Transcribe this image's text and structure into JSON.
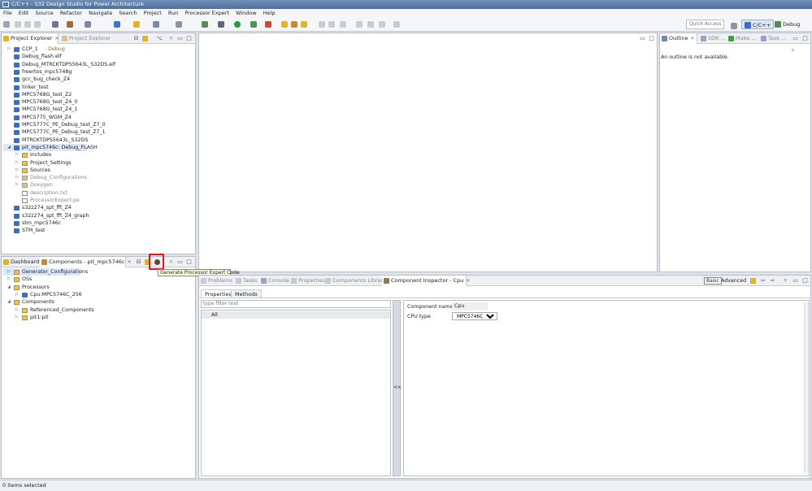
{
  "window": {
    "title": "C/C++ - S32 Design Studio for Power Architecture"
  },
  "menu": [
    "File",
    "Edit",
    "Source",
    "Refactor",
    "Navigate",
    "Search",
    "Project",
    "Run",
    "Processor Expert",
    "Window",
    "Help"
  ],
  "toolbar": {
    "quick_access": "Quick Access",
    "perspective_cpp": "C/C++",
    "perspective_debug": "Debug"
  },
  "project_explorer": {
    "tab_label": "Project Explorer",
    "tab2_label": "Project Explorer",
    "items": [
      {
        "label": "CCP_1",
        "suffix": ": Debug"
      },
      {
        "label": "Debug_flash.elf",
        "suffix": ""
      },
      {
        "label": "Debug_MTRCKTDPS5643L_S32DS.elf",
        "suffix": ""
      },
      {
        "label": "freertos_mpc5748g",
        "suffix": ""
      },
      {
        "label": "gcc_bug_check_Z4",
        "suffix": ""
      },
      {
        "label": "linker_test",
        "suffix": ""
      },
      {
        "label": "MPC5768G_test_Z2",
        "suffix": ""
      },
      {
        "label": "MPC5768G_test_Z4_0",
        "suffix": ""
      },
      {
        "label": "MPC5768G_test_Z4_1",
        "suffix": ""
      },
      {
        "label": "MPC5775_WGM_Z4",
        "suffix": ""
      },
      {
        "label": "MPC5777C_PE_Debug_test_Z7_0",
        "suffix": ""
      },
      {
        "label": "MPC5777C_PE_Debug_test_Z7_1",
        "suffix": ""
      },
      {
        "label": "MTRCKTDPS5643L_S32DS",
        "suffix": ""
      },
      {
        "label": "pit_mpc5746c: Debug_FLASH",
        "suffix": ""
      },
      {
        "label": "Includes",
        "suffix": ""
      },
      {
        "label": "Project_Settings",
        "suffix": ""
      },
      {
        "label": "Sources",
        "suffix": ""
      },
      {
        "label": "Debug_Configurations",
        "suffix": ""
      },
      {
        "label": "Doxygen",
        "suffix": ""
      },
      {
        "label": "description.txt",
        "suffix": ""
      },
      {
        "label": "ProcessorExpert.pe",
        "suffix": ""
      },
      {
        "label": "s32z274_spt_fft_Z4",
        "suffix": ""
      },
      {
        "label": "s32z274_spt_fft_Z4_graph",
        "suffix": ""
      },
      {
        "label": "stm_mpc5746c",
        "suffix": ""
      },
      {
        "label": "STM_test",
        "suffix": ""
      }
    ]
  },
  "outline": {
    "tabs": [
      "Outline",
      "SDK ...",
      "Make ...",
      "Task ..."
    ],
    "message": "An outline is not available."
  },
  "components_panel": {
    "tabs": [
      "Dashboard",
      "Components - pit_mpc5746c"
    ],
    "items": [
      {
        "label": "Generator_Configurations"
      },
      {
        "label": "OSs"
      },
      {
        "label": "Processors"
      },
      {
        "label": "Cpu:MPC5746C_256"
      },
      {
        "label": "Components"
      },
      {
        "label": "Referenced_Components"
      },
      {
        "label": "pit1:pit"
      }
    ],
    "tooltip": "Generate Processor Expert Code"
  },
  "bottom_tabs": [
    "Problems",
    "Tasks",
    "Console",
    "Properties",
    "Components Library",
    "Component Inspector - Cpu"
  ],
  "inspector": {
    "mode_basic": "Basic",
    "mode_advanced": "Advanced",
    "subtabs": [
      "Properties",
      "Methods"
    ],
    "filter_placeholder": "type filter text",
    "filter_all": "All",
    "collapse": "<<",
    "fields": [
      {
        "label": "Component name",
        "value": "Cpu"
      },
      {
        "label": "CPU type",
        "value": "MPC5746C_256"
      }
    ]
  },
  "status": {
    "text": "0 items selected"
  },
  "colors": {
    "highlight": "#e0151e",
    "tooltip_bg": "#ffffe1",
    "title_bar": "#4d6f9a"
  }
}
